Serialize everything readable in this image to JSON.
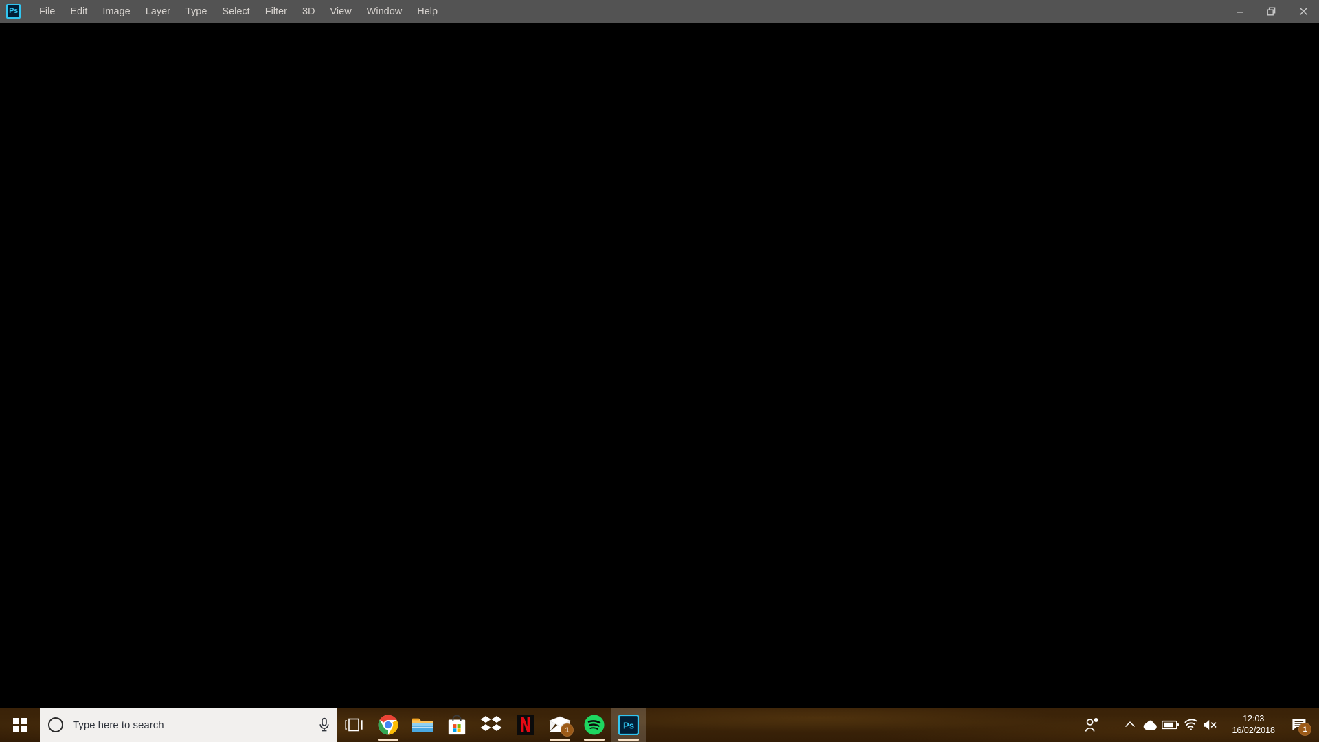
{
  "application": {
    "name": "Adobe Photoshop",
    "app_icon": "photoshop-icon",
    "app_icon_label": "Ps",
    "accent_color": "#31c5f0",
    "menubar_color": "#535353",
    "canvas_color": "#000000",
    "menu_items": [
      {
        "label": "File"
      },
      {
        "label": "Edit"
      },
      {
        "label": "Image"
      },
      {
        "label": "Layer"
      },
      {
        "label": "Type"
      },
      {
        "label": "Select"
      },
      {
        "label": "Filter"
      },
      {
        "label": "3D"
      },
      {
        "label": "View"
      },
      {
        "label": "Window"
      },
      {
        "label": "Help"
      }
    ],
    "window_controls": [
      {
        "name": "minimize-button",
        "icon": "minimize-icon"
      },
      {
        "name": "restore-button",
        "icon": "restore-icon"
      },
      {
        "name": "close-button",
        "icon": "close-icon"
      }
    ]
  },
  "taskbar": {
    "background_color": "#3d2509",
    "start": {
      "icon": "windows-logo-icon",
      "label": "Start"
    },
    "search": {
      "placeholder": "Type here to search",
      "cortana_icon": "cortana-circle-icon",
      "mic_icon": "microphone-icon",
      "background_color": "#f2f0ee"
    },
    "pinned": [
      {
        "name": "task-view",
        "label": "Task View",
        "icon": "task-view-icon",
        "running": false,
        "badge": ""
      },
      {
        "name": "chrome",
        "label": "Google Chrome",
        "icon": "chrome-icon",
        "running": true,
        "badge": ""
      },
      {
        "name": "file-explorer",
        "label": "File Explorer",
        "icon": "file-explorer-icon",
        "running": false,
        "badge": ""
      },
      {
        "name": "microsoft-store",
        "label": "Microsoft Store",
        "icon": "microsoft-store-icon",
        "running": false,
        "badge": ""
      },
      {
        "name": "dropbox",
        "label": "Dropbox",
        "icon": "dropbox-icon",
        "running": false,
        "badge": ""
      },
      {
        "name": "netflix",
        "label": "Netflix",
        "icon": "netflix-icon",
        "running": false,
        "badge": ""
      },
      {
        "name": "mail",
        "label": "Mail",
        "icon": "mail-icon",
        "running": true,
        "badge": "1"
      },
      {
        "name": "spotify",
        "label": "Spotify",
        "icon": "spotify-icon",
        "running": true,
        "badge": ""
      },
      {
        "name": "photoshop",
        "label": "Adobe Photoshop",
        "icon": "photoshop-icon",
        "running": true,
        "active": true,
        "badge": ""
      }
    ],
    "tray": {
      "people_icon": "people-icon",
      "chevron_icon": "chevron-up-icon",
      "onedrive_icon": "onedrive-cloud-icon",
      "battery_icon": "battery-icon",
      "wifi_icon": "wifi-icon",
      "volume_icon": "volume-muted-icon",
      "clock": {
        "time": "12:03",
        "date": "16/02/2018"
      },
      "action_center": {
        "icon": "action-center-icon",
        "badge": "1"
      },
      "show_desktop": "show-desktop-button"
    }
  }
}
